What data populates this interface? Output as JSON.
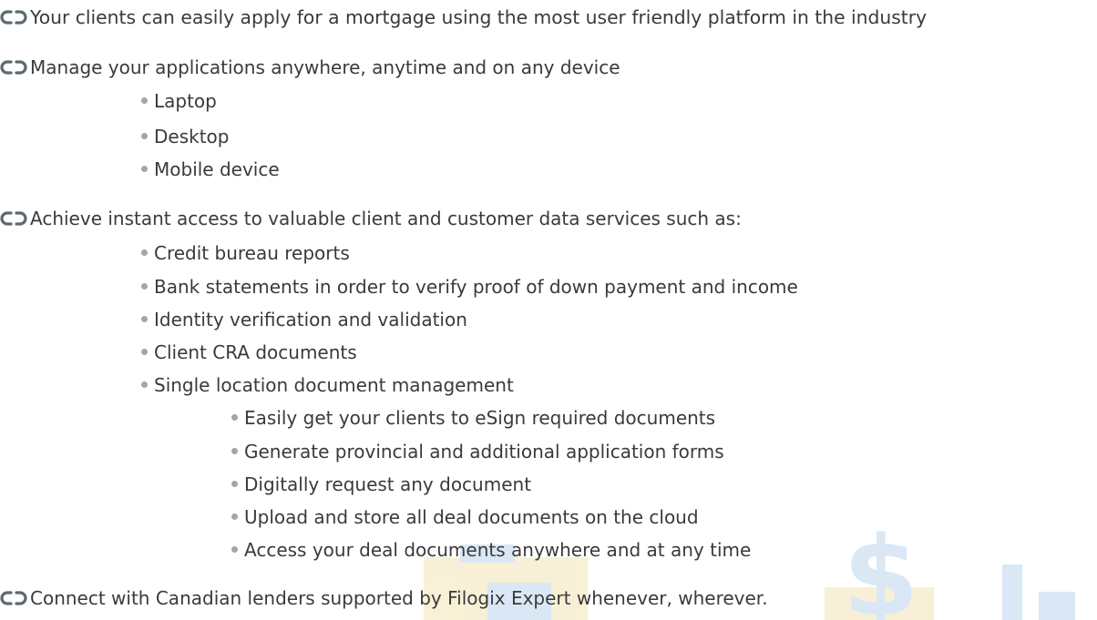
{
  "colors": {
    "text": "#3a3a3a",
    "link_icon": "#5a6a72",
    "bullet": "#9ea7ad",
    "watermark_blue": "#d6e6f4",
    "watermark_yellow": "#f7efd2"
  },
  "features": [
    {
      "icon": "link-icon",
      "text": "Your clients can easily apply for a mortgage using the most user friendly platform in the industry"
    },
    {
      "icon": "link-icon",
      "text": "Manage your applications anywhere, anytime and on any device",
      "bullets": [
        "Laptop",
        "Desktop",
        "Mobile device"
      ]
    },
    {
      "icon": "link-icon",
      "text": "Achieve instant access to valuable client and customer data services such as:",
      "bullets": [
        "Credit bureau reports",
        "Bank statements in order to verify proof of down payment and income",
        "Identity verification and validation",
        "Client CRA documents",
        "Single location document management"
      ],
      "sub_bullets": [
        "Easily get your clients to eSign required documents",
        "Generate provincial and additional application forms",
        "Digitally request any document",
        "Upload and store all deal documents on the cloud",
        "Access your deal documents anywhere and at any time"
      ]
    },
    {
      "icon": "link-icon",
      "text": "Connect with Canadian lenders supported by Filogix Expert whenever, wherever."
    }
  ]
}
